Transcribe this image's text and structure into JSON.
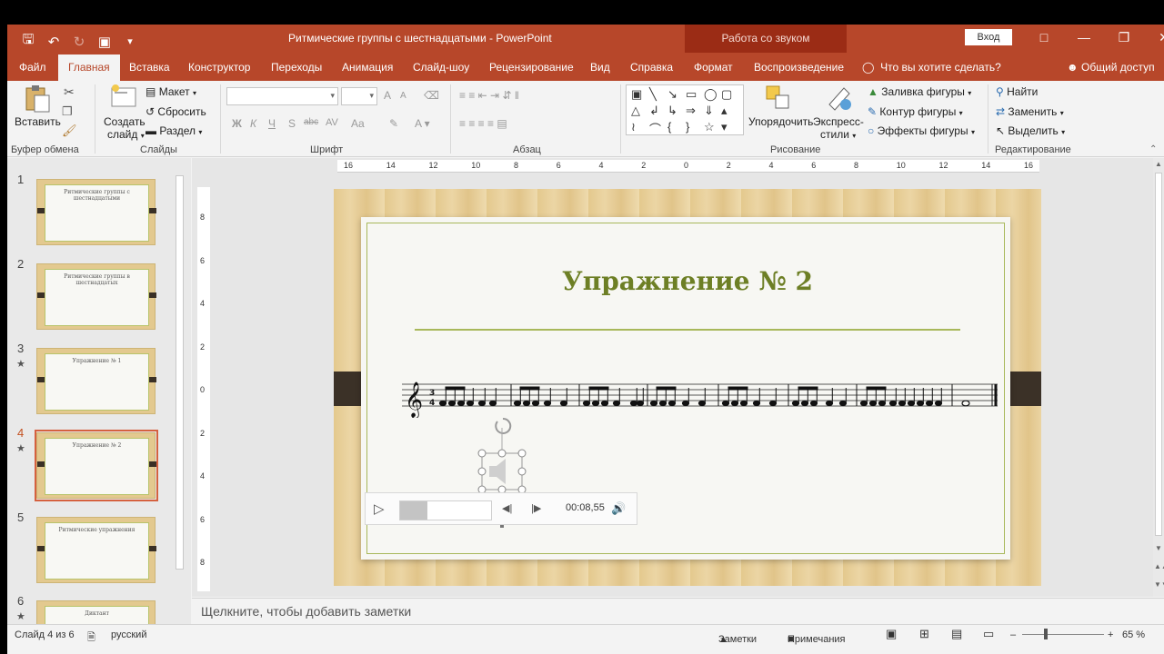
{
  "titlebar": {
    "doc_title": "Ритмические группы с шестнадцатыми  -  PowerPoint",
    "context_title": "Работа со звуком",
    "login": "Вход",
    "qat_icons": [
      "save-icon",
      "undo-icon",
      "redo-icon",
      "start-presentation-icon",
      "customize-icon"
    ]
  },
  "tabs": [
    "Файл",
    "Главная",
    "Вставка",
    "Конструктор",
    "Переходы",
    "Анимация",
    "Слайд-шоу",
    "Рецензирование",
    "Вид",
    "Справка",
    "Формат",
    "Воспроизведение"
  ],
  "active_tab": "Главная",
  "tell_me": "Что вы хотите сделать?",
  "share": "Общий доступ",
  "ribbon": {
    "clipboard": {
      "paste": "Вставить",
      "label": "Буфер обмена"
    },
    "slides": {
      "create": "Создать",
      "create2": "слайд",
      "layout": "Макет",
      "reset": "Сбросить",
      "section": "Раздел",
      "label": "Слайды"
    },
    "font": {
      "label": "Шрифт",
      "bold": "Ж",
      "italic": "К",
      "underline": "Ч",
      "strike": "S",
      "abc": "abc",
      "spacing": "AV",
      "case": "Aa",
      "size_up": "A",
      "size_down": "A"
    },
    "paragraph": {
      "label": "Абзац"
    },
    "drawing": {
      "arrange": "Упорядочить",
      "quick_styles": "Экспресс-",
      "quick_styles2": "стили",
      "fill": "Заливка фигуры",
      "outline": "Контур фигуры",
      "effects": "Эффекты фигуры",
      "label": "Рисование"
    },
    "editing": {
      "find": "Найти",
      "replace": "Заменить",
      "select": "Выделить",
      "label": "Редактирование"
    }
  },
  "thumbnails": [
    {
      "num": "1",
      "title": "Ритмические группы с шестнадцатыми",
      "star": ""
    },
    {
      "num": "2",
      "title": "Ритмические группы в шестнадцатых",
      "star": ""
    },
    {
      "num": "3",
      "title": "Упражнение № 1",
      "star": "★"
    },
    {
      "num": "4",
      "title": "Упражнение № 2",
      "star": "★"
    },
    {
      "num": "5",
      "title": "Ритмические упражнения",
      "star": ""
    },
    {
      "num": "6",
      "title": "Диктант",
      "star": "★"
    }
  ],
  "selected_slide": "4",
  "ruler": {
    "h": [
      "16",
      "14",
      "12",
      "10",
      "8",
      "6",
      "4",
      "2",
      "0",
      "2",
      "4",
      "6",
      "8",
      "10",
      "12",
      "14",
      "16"
    ],
    "v": [
      "8",
      "6",
      "4",
      "2",
      "0",
      "2",
      "4",
      "6",
      "8"
    ]
  },
  "slide": {
    "title": "Упражнение № 2",
    "media": {
      "time": "00:08,55",
      "progress": 0.3
    }
  },
  "notes_placeholder": "Щелкните, чтобы добавить заметки",
  "status": {
    "slide_info": "Слайд 4 из 6",
    "language": "русский",
    "notes": "Заметки",
    "comments": "Примечания",
    "zoom": "65 %"
  }
}
